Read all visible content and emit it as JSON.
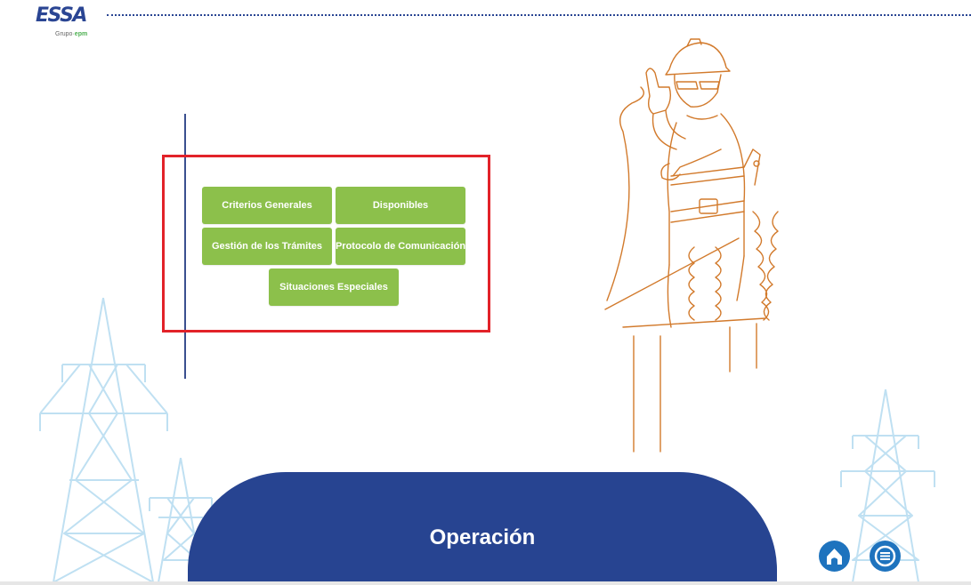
{
  "header": {
    "logo_text": "ESSA",
    "logo_sub_prefix": "Grupo·",
    "logo_sub_brand": "epm"
  },
  "menu": {
    "buttons": [
      {
        "label": "Criterios Generales"
      },
      {
        "label": "Disponibles"
      },
      {
        "label": "Gestión de los Trámites"
      },
      {
        "label": "Protocolo de Comunicación"
      },
      {
        "label": "Situaciones Especiales"
      }
    ]
  },
  "banner": {
    "title": "Operación"
  },
  "icons": {
    "home": "home-icon",
    "menu": "list-icon"
  },
  "colors": {
    "brand_blue": "#274491",
    "button_green": "#8cc04b",
    "highlight_red": "#e22229",
    "icon_blue": "#1e73be",
    "tower_blue": "#bfe0f2",
    "illustration_orange": "#d27a2c"
  }
}
